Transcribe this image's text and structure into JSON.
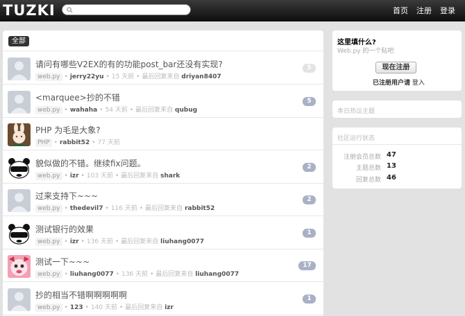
{
  "header": {
    "logo": "TUZKI",
    "search_placeholder": "",
    "nav": [
      "首页",
      "注册",
      "登录"
    ]
  },
  "main": {
    "tab_all": "全部",
    "topics": [
      {
        "title": "请问有哪些V2EX的有的功能post_bar还没有实现?",
        "node": "web.py",
        "author": "jerry22yu",
        "time": "15 天前",
        "last_label": "最后回复来自",
        "last_user": "driyan8407",
        "count": "5",
        "avatar": "default"
      },
      {
        "title": "<marquee>抄的不错",
        "node": "web.py",
        "author": "wahaha",
        "time": "54 天前",
        "last_label": "最后回复来自",
        "last_user": "qubug",
        "count": "5",
        "avatar": "default"
      },
      {
        "title": "PHP 为毛是大象?",
        "node": "PHP",
        "author": "rabbit52",
        "time": "77 天前",
        "last_label": "",
        "last_user": "",
        "count": "",
        "avatar": "rabbit"
      },
      {
        "title": "貌似做的不错。继续fix问题。",
        "node": "web.py",
        "author": "izr",
        "time": "103 天前",
        "last_label": "最后回复来自",
        "last_user": "shark",
        "count": "2",
        "avatar": "panda"
      },
      {
        "title": "过来支持下~~~",
        "node": "web.py",
        "author": "thedevil7",
        "time": "116 天前",
        "last_label": "最后回复来自",
        "last_user": "rabbit52",
        "count": "2",
        "avatar": "default"
      },
      {
        "title": "测试银行的效果",
        "node": "web.py",
        "author": "izr",
        "time": "136 天前",
        "last_label": "最后回复来自",
        "last_user": "liuhang0077",
        "count": "1",
        "avatar": "panda"
      },
      {
        "title": "测试一下~~~",
        "node": "web.py",
        "author": "liuhang0077",
        "time": "136 天前",
        "last_label": "最后回复来自",
        "last_user": "liuhang0077",
        "count": "17",
        "avatar": "pink"
      },
      {
        "title": "抄的相当不错啊啊啊啊啊",
        "node": "web.py",
        "author": "123",
        "time": "140 天前",
        "last_label": "最后回复来自",
        "last_user": "izr",
        "count": "1",
        "avatar": "default"
      }
    ]
  },
  "sidebar": {
    "about_title": "这里填什么?",
    "about_sub": "Web.py 的一个贴吧",
    "register_button": "现在注册",
    "registered_prefix": "已注册用户请",
    "login_link": "登入",
    "today_title": "本日热议主题",
    "status_title": "社区运行状态",
    "stats": [
      {
        "label": "注册会员总数",
        "value": "47"
      },
      {
        "label": "主题总数",
        "value": "13"
      },
      {
        "label": "回复总数",
        "value": "46"
      }
    ]
  },
  "colors": {
    "count_badge": "#aab0c6",
    "topbar": "#1a1a1a"
  }
}
